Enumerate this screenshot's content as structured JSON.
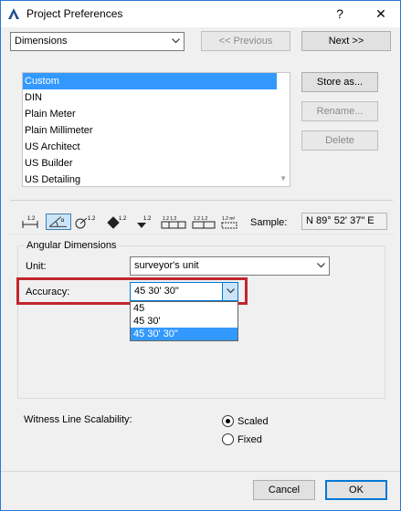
{
  "window": {
    "title": "Project Preferences",
    "help_glyph": "?",
    "close_glyph": "✕"
  },
  "header": {
    "category_value": "Dimensions",
    "previous_label": "<< Previous",
    "next_label": "Next >>"
  },
  "presets": {
    "items": [
      "Custom",
      "DIN",
      "Plain Meter",
      "Plain Millimeter",
      "US Architect",
      "US Builder",
      "US Detailing"
    ],
    "selected": "Custom",
    "store_label": "Store as...",
    "rename_label": "Rename...",
    "delete_label": "Delete"
  },
  "toolbar": {
    "icons": [
      {
        "name": "linear-dimensions-icon",
        "caption": "1.2"
      },
      {
        "name": "angular-dimensions-icon",
        "caption": "α"
      },
      {
        "name": "radial-dimensions-icon",
        "caption": "1.2"
      },
      {
        "name": "level-dimensions-icon",
        "caption": "1.2"
      },
      {
        "name": "elevation-dimensions-icon",
        "caption": "1.2"
      },
      {
        "name": "door-window-dimensions-icon",
        "caption": ""
      },
      {
        "name": "sill-height-icon",
        "caption": ""
      },
      {
        "name": "area-calculation-icon",
        "caption": "1.2 m²"
      }
    ],
    "sample_label": "Sample:",
    "sample_value": "N 89° 52' 37\" E"
  },
  "angular": {
    "group_title": "Angular Dimensions",
    "unit_label": "Unit:",
    "unit_value": "surveyor's unit",
    "accuracy_label": "Accuracy:",
    "accuracy_value": "45 30' 30\"",
    "accuracy_options": [
      "45",
      "45 30'",
      "45 30' 30\""
    ],
    "accuracy_selected": "45 30' 30\""
  },
  "witness": {
    "label": "Witness Line Scalability:",
    "options": [
      "Scaled",
      "Fixed"
    ],
    "selected": "Scaled"
  },
  "footer": {
    "cancel_label": "Cancel",
    "ok_label": "OK"
  },
  "colors": {
    "selection": "#3399ff",
    "highlight_border": "#c0262d",
    "window_border": "#2b78d4"
  }
}
